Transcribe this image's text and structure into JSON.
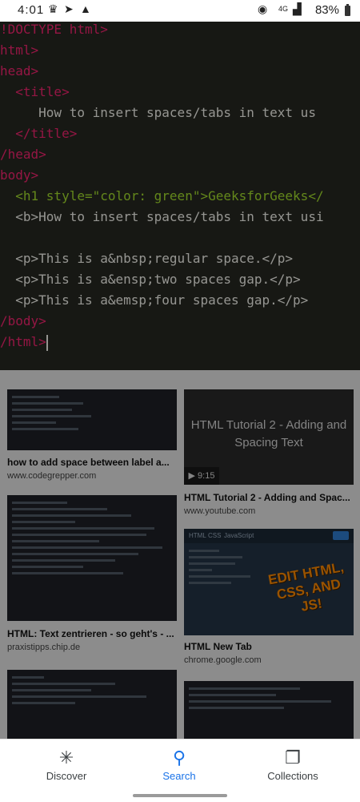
{
  "status_bar": {
    "time": "4:01",
    "network": "4G",
    "battery": "83%"
  },
  "code_preview": {
    "lines": [
      "!DOCTYPE html>",
      "html>",
      "head>",
      "  <title>",
      "     How to insert spaces/tabs in text us",
      "  </title>",
      "/head>",
      "body>",
      "  <h1 style=\"color: green\">GeeksforGeeks</",
      "  <b>How to insert spaces/tabs in text usi",
      "",
      "  <p>This is a&nbsp;regular space.</p>",
      "  <p>This is a&ensp;two spaces gap.</p>",
      "  <p>This is a&emsp;four spaces gap.</p>",
      "/body>",
      "/html>"
    ]
  },
  "results": [
    {
      "title": "how to add space between label a...",
      "site": "www.codegrepper.com"
    },
    {
      "title": "HTML Tutorial 2 - Adding and Spac...",
      "site": "www.youtube.com",
      "thumb_text": "HTML Tutorial 2 - Adding and Spacing Text",
      "duration": "9:15"
    },
    {
      "title": "HTML: Text zentrieren - so geht's - ...",
      "site": "praxistipps.chip.de"
    },
    {
      "title": "HTML New Tab",
      "site": "chrome.google.com",
      "thumb_tabs": [
        "HTML",
        "CSS",
        "JavaScript"
      ],
      "badge": "EDIT HTML, CSS, AND JS!"
    }
  ],
  "bottom_nav": {
    "items": [
      {
        "label": "Discover",
        "icon": "asterisk-icon"
      },
      {
        "label": "Search",
        "icon": "search-icon",
        "active": true
      },
      {
        "label": "Collections",
        "icon": "bookmarks-icon"
      }
    ]
  },
  "colors": {
    "active": "#1a73e8",
    "code_bg": "#272822",
    "tag": "#f92672",
    "attribute": "#a6e22e",
    "string": "#e6db74",
    "entity": "#ae81ff"
  }
}
